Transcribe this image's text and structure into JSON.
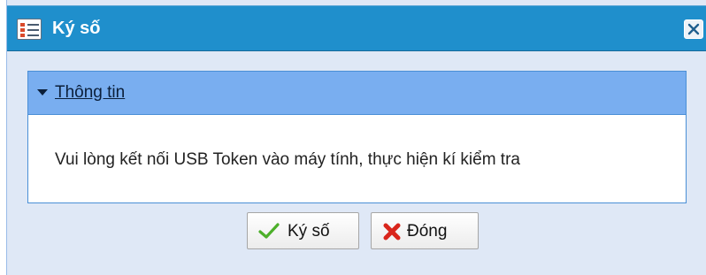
{
  "window": {
    "title": "Ký số",
    "title_icon": "form-icon",
    "close_icon": "close-icon"
  },
  "panel": {
    "header": "Thông tin",
    "collapse_icon": "caret-down-icon",
    "message": "Vui lòng kết nối USB Token vào máy tính, thực hiện kí kiểm tra"
  },
  "buttons": {
    "sign": {
      "label": "Ký số",
      "icon": "checkmark-icon",
      "icon_color": "#4caf2a"
    },
    "close": {
      "label": "Đóng",
      "icon": "red-x-icon",
      "icon_color": "#d9261c"
    }
  },
  "colors": {
    "titlebar": "#1f8fcc",
    "panel_header": "#79aef0",
    "dialog_background": "#dfe8f6"
  }
}
